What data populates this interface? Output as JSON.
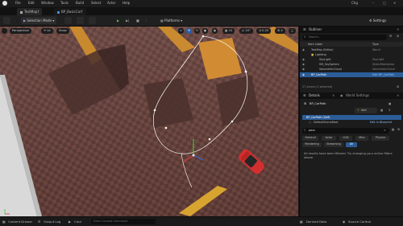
{
  "menu": [
    "File",
    "Edit",
    "Window",
    "Tools",
    "Build",
    "Select",
    "Actor",
    "Help"
  ],
  "window_user": "Chg",
  "tabs": [
    {
      "label": "TestMap†",
      "active": true
    },
    {
      "label": "BP_BasicCar†",
      "active": false
    }
  ],
  "toolbar": {
    "save_label": "",
    "mode_label": "Selection Mode",
    "platforms_label": "Platforms",
    "settings_label": "Settings"
  },
  "viewport": {
    "perspective_label": "Perspective",
    "lit_label": "Lit",
    "show_label": "Show",
    "snap_value_1": "10",
    "snap_value_2": "10°",
    "snap_value_3": "0.25",
    "camera_speed": "4"
  },
  "outliner": {
    "tab_label": "Outliner",
    "search_placeholder": "Search...",
    "col_item_label": "Item Label",
    "col_type": "Type",
    "items": [
      {
        "label": "TestMap (Editor)",
        "type": "World",
        "indent": 1,
        "selected": false
      },
      {
        "label": "Lighting",
        "type": "",
        "indent": 2,
        "selected": false
      },
      {
        "label": "SkyLight",
        "type": "SkyLight",
        "indent": 3,
        "selected": false
      },
      {
        "label": "SM_SkySphere",
        "type": "StaticMeshActor",
        "indent": 3,
        "selected": false
      },
      {
        "label": "VolumetricCloud",
        "type": "VolumetricCloud",
        "indent": 3,
        "selected": false
      },
      {
        "label": "BP_CarPath",
        "type": "Edit BP_CarPath",
        "indent": 1,
        "selected": true
      }
    ],
    "footer": "27 actors (1 selected)"
  },
  "details": {
    "tab_label": "Details",
    "tab2_label": "World Settings",
    "actor_name": "BP_CarPath",
    "add_label": "Add",
    "component_self": "BP_CarPath (Self)",
    "component_root": "DefaultSceneRoot",
    "component_root_link": "Edit in Blueprint",
    "search_value": "pass",
    "filters": [
      "General",
      "Actor",
      "LOD",
      "Misc",
      "Physics",
      "Rendering",
      "Streaming",
      "All"
    ],
    "active_filter": "All",
    "message": "All results have been filtered. Try changing your active filters above."
  },
  "statusbar": {
    "content_drawer": "Content Drawer",
    "output_log": "Output Log",
    "cmd": "Cmd",
    "console_placeholder": "Enter Console Command",
    "derived_data": "Derived Data",
    "source_control": "Source Control"
  }
}
